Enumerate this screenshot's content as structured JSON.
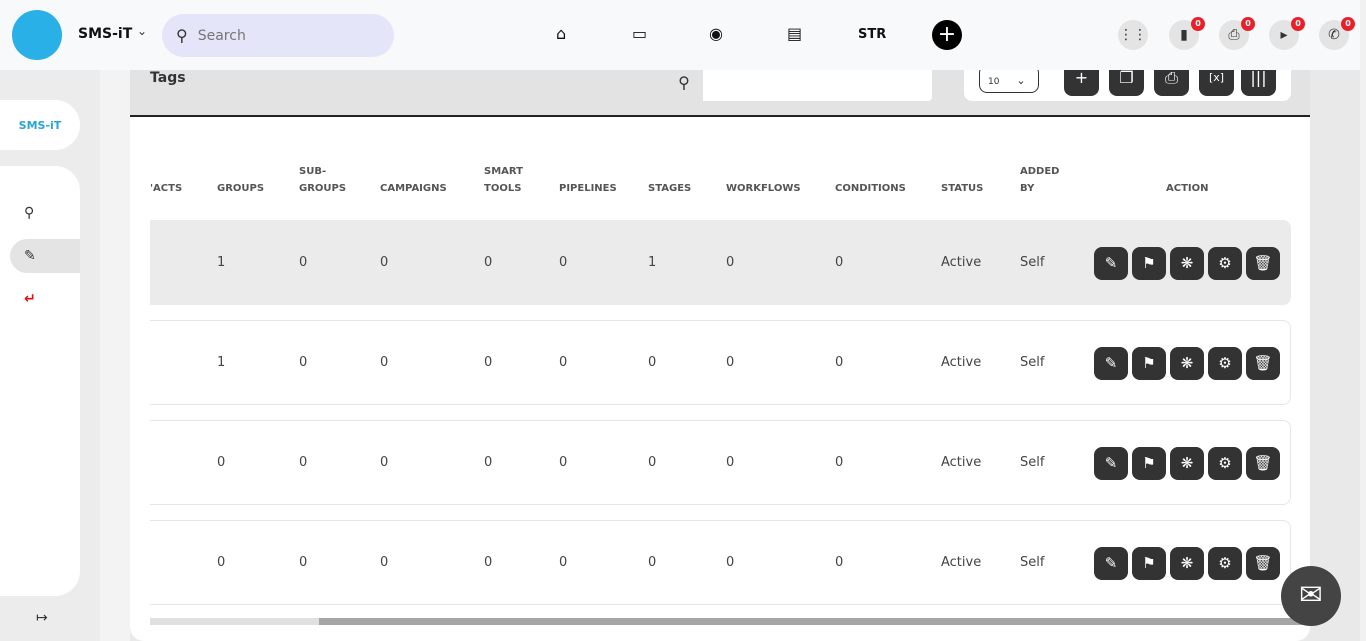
{
  "topbar": {
    "brand": "SMS-iT",
    "search_placeholder": "Search",
    "nav": [
      {
        "icon": "home-icon"
      },
      {
        "icon": "monitor-icon"
      },
      {
        "icon": "robot-icon"
      },
      {
        "icon": "store-icon"
      }
    ],
    "str_label": "STR",
    "notifications": [
      {
        "icon": "chat-icon",
        "count": "0"
      },
      {
        "icon": "printer-icon",
        "count": "0"
      },
      {
        "icon": "megaphone-icon",
        "count": "0"
      },
      {
        "icon": "phone-icon",
        "count": "0"
      }
    ]
  },
  "sidebar": {
    "logo_text": "SMS-iT",
    "items": [
      {
        "icon": "analytics-search-icon"
      },
      {
        "icon": "edit-icon",
        "active": true
      },
      {
        "icon": "return-icon"
      }
    ]
  },
  "panel": {
    "title": "Tags",
    "page_size": "10"
  },
  "table": {
    "columns": [
      "'ACTS",
      "GROUPS",
      "SUB-\nGROUPS",
      "CAMPAIGNS",
      "SMART\nTOOLS",
      "PIPELINES",
      "STAGES",
      "WORKFLOWS",
      "CONDITIONS",
      "STATUS",
      "ADDED\nBY",
      "ACTION"
    ],
    "rows": [
      [
        "1",
        "0",
        "0",
        "0",
        "0",
        "1",
        "0",
        "0",
        "Active",
        "Self"
      ],
      [
        "1",
        "0",
        "0",
        "0",
        "0",
        "0",
        "0",
        "0",
        "Active",
        "Self"
      ],
      [
        "0",
        "0",
        "0",
        "0",
        "0",
        "0",
        "0",
        "0",
        "Active",
        "Self"
      ],
      [
        "0",
        "0",
        "0",
        "0",
        "0",
        "0",
        "0",
        "0",
        "Active",
        "Self"
      ]
    ]
  },
  "colors": {
    "accent": "#29b0e6",
    "badge": "#e8202a",
    "button": "#333333"
  }
}
